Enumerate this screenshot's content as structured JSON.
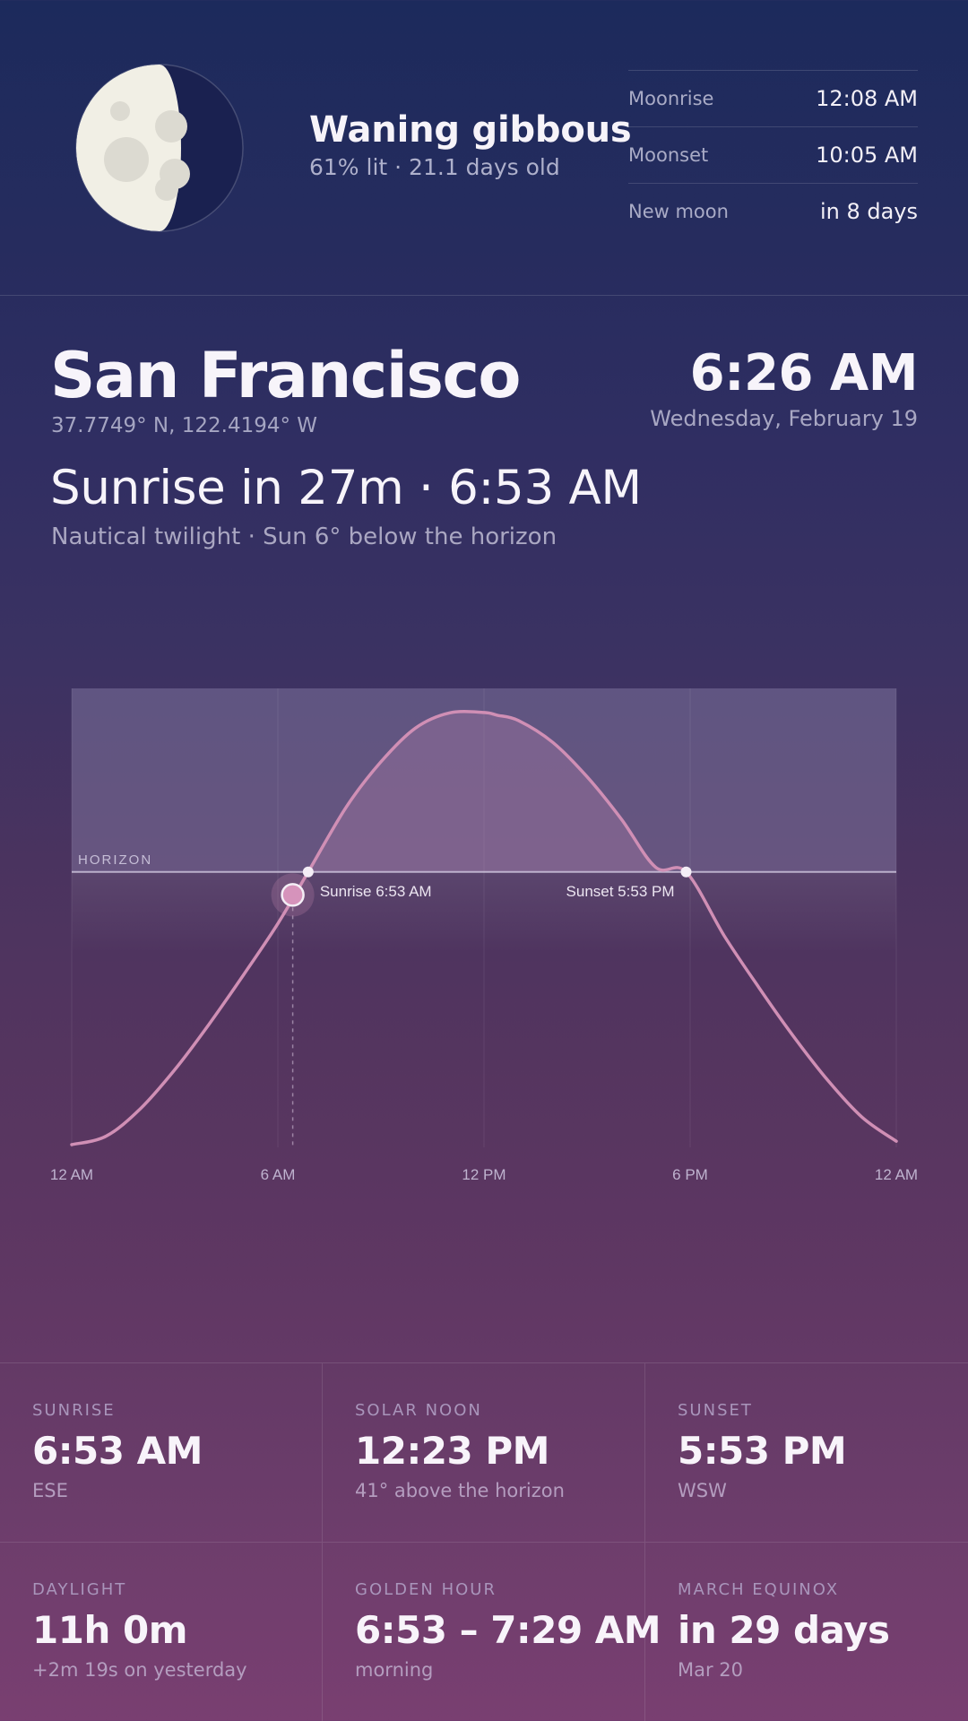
{
  "moon": {
    "phase_name": "Waning gibbous",
    "phase_detail": "61% lit · 21.1 days old",
    "illumination_fraction": 0.61,
    "events": [
      {
        "label": "Moonrise",
        "value": "12:08 AM"
      },
      {
        "label": "Moonset",
        "value": "10:05 AM"
      },
      {
        "label": "New moon",
        "value": "in 8 days"
      }
    ]
  },
  "location": {
    "city": "San Francisco",
    "coordinates": "37.7749° N, 122.4194° W"
  },
  "now": {
    "time": "6:26 AM",
    "date": "Wednesday, February 19"
  },
  "headline": "Sunrise in 27m · 6:53 AM",
  "subline": "Nautical twilight · Sun 6° below the horizon",
  "chart": {
    "horizon_label": "HORIZON",
    "sunrise_label": "Sunrise 6:53 AM",
    "sunset_label": "Sunset 5:53 PM",
    "colors": {
      "curve": "#d08fb5",
      "marker": "#d693bb",
      "day_fill": "#6a5e86"
    }
  },
  "chart_data": {
    "type": "line",
    "x_unit": "hour of day",
    "y_unit": "sun altitude (degrees)",
    "x_ticks": [
      0,
      6,
      12,
      18,
      24
    ],
    "x_tick_labels": [
      "12 AM",
      "6 AM",
      "12 PM",
      "6 PM",
      "12 AM"
    ],
    "series": [
      {
        "x": [
          0,
          1,
          2,
          3,
          4,
          5,
          6,
          6.883,
          8,
          9,
          10,
          11,
          12,
          12.383,
          13,
          14,
          15,
          16,
          17,
          17.883,
          19,
          20,
          21,
          22,
          23,
          24
        ],
        "y": [
          -71.3,
          -69.1,
          -61.9,
          -51.7,
          -39.8,
          -26.9,
          -13.5,
          0,
          17.1,
          28.8,
          37.6,
          41.6,
          41.7,
          41.0,
          39.6,
          33.9,
          24.9,
          13.8,
          1.2,
          0,
          -16.8,
          -30.2,
          -42.9,
          -54.4,
          -64.1,
          -70.4
        ]
      }
    ],
    "sunrise_hour": 6.883,
    "sunset_hour": 17.883,
    "current_hour": 6.433,
    "current_altitude": -6,
    "ylim": [
      -72,
      48
    ]
  },
  "stats": [
    {
      "label": "Sunrise",
      "value": "6:53 AM",
      "sub": "ESE"
    },
    {
      "label": "Solar noon",
      "value": "12:23 PM",
      "sub": "41° above the horizon"
    },
    {
      "label": "Sunset",
      "value": "5:53 PM",
      "sub": "WSW"
    },
    {
      "label": "Daylight",
      "value": "11h 0m",
      "sub": "+2m 19s on yesterday"
    },
    {
      "label": "Golden hour",
      "value": "6:53 – 7:29 AM",
      "sub": "morning"
    },
    {
      "label": "March equinox",
      "value": "in 29 days",
      "sub": "Mar 20"
    }
  ]
}
